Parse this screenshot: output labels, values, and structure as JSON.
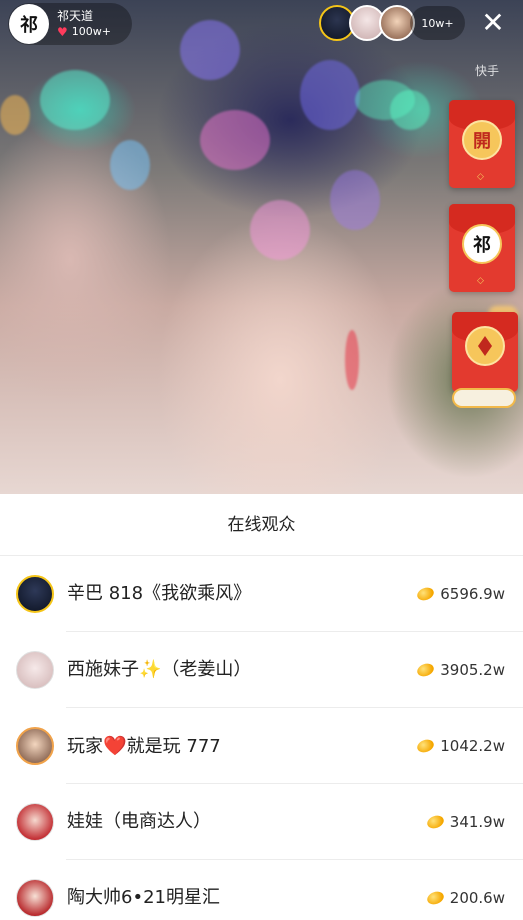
{
  "host": {
    "name": "祁天道",
    "likes": "100w+",
    "avatar_text": "祁"
  },
  "top_bar": {
    "viewer_count": "10w+",
    "close_symbol": "✕",
    "watermark": "快手"
  },
  "envelopes": [
    {
      "label": "開",
      "style": "gold"
    },
    {
      "label": "祁",
      "style": "portrait"
    },
    {
      "label": "",
      "style": "diamond"
    }
  ],
  "audience": {
    "title": "在线观众",
    "viewers": [
      {
        "name": "辛巴 818《我欲乘风》",
        "coins": "6596.9w",
        "avatar": "dark-portrait"
      },
      {
        "name_prefix": "西施妹子",
        "emoji": "✨",
        "name_suffix": "（老姜山）",
        "coins": "3905.2w",
        "avatar": "light-portrait"
      },
      {
        "name_prefix": "玩家",
        "emoji": "❤️",
        "name_suffix": "就是玩 777",
        "coins": "1042.2w",
        "avatar": "male-portrait"
      },
      {
        "name": "娃娃（电商达人）",
        "coins": "341.9w",
        "avatar": "red-portrait"
      },
      {
        "name": "陶大帅6•21明星汇",
        "coins": "200.6w",
        "avatar": "female-portrait"
      }
    ]
  },
  "colors": {
    "accent_red": "#e33a2f",
    "coin_gold": "#f5a700",
    "heart": "#ff3b5c"
  },
  "icons": {
    "close": "close-icon",
    "heart": "heart-icon",
    "coin": "coin-icon"
  }
}
